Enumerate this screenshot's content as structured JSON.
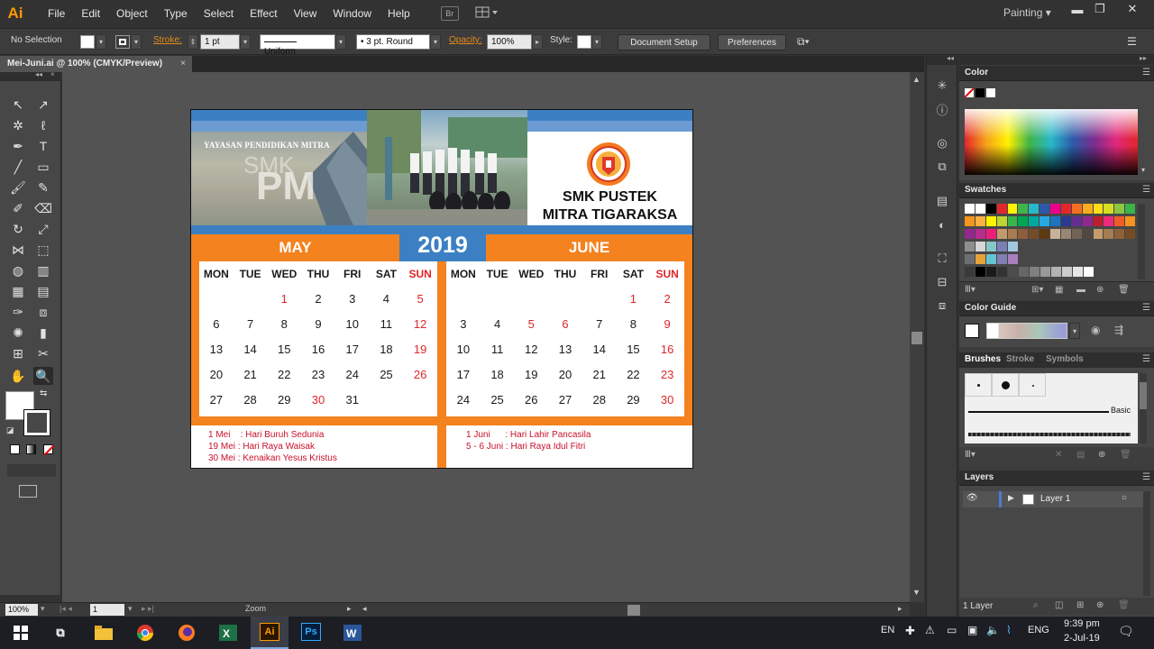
{
  "menubar": {
    "app_logo": "Ai",
    "items": [
      "File",
      "Edit",
      "Object",
      "Type",
      "Select",
      "Effect",
      "View",
      "Window",
      "Help"
    ],
    "bridge": "Br",
    "workspace": "Painting"
  },
  "controlbar": {
    "selection": "No Selection",
    "stroke_label": "Stroke:",
    "stroke_weight": "1 pt",
    "stroke_profile": "Uniform",
    "brush": "3 pt. Round",
    "opacity_label": "Opacity:",
    "opacity_value": "100%",
    "style_label": "Style:",
    "document_setup": "Document Setup",
    "preferences": "Preferences"
  },
  "document": {
    "tab_title": "Mei-Juni.ai @ 100% (CMYK/Preview)"
  },
  "statusbar": {
    "zoom": "100%",
    "artboard": "1",
    "tool": "Zoom"
  },
  "panels": {
    "color": "Color",
    "swatches": "Swatches",
    "color_guide": "Color Guide",
    "brushes_tabs": [
      "Brushes",
      "Stroke",
      "Symbols"
    ],
    "brush_basic": "Basic",
    "layers": "Layers",
    "layer_name": "Layer 1",
    "layer_count": "1 Layer"
  },
  "artwork": {
    "foundation": "YAYASAN PENDIDIKAN MITRA",
    "school_line1": "SMK PUSTEK",
    "school_line2": "MITRA TIGARAKSA",
    "year": "2019",
    "months": [
      {
        "name": "MAY",
        "days_header": [
          "MON",
          "TUE",
          "WED",
          "THU",
          "FRI",
          "SAT",
          "SUN"
        ],
        "weeks": [
          [
            "",
            "",
            "1",
            "2",
            "3",
            "4",
            "5"
          ],
          [
            "6",
            "7",
            "8",
            "9",
            "10",
            "11",
            "12"
          ],
          [
            "13",
            "14",
            "15",
            "16",
            "17",
            "18",
            "19"
          ],
          [
            "20",
            "21",
            "22",
            "23",
            "24",
            "25",
            "26"
          ],
          [
            "27",
            "28",
            "29",
            "30",
            "31",
            "",
            ""
          ]
        ],
        "holidays": [
          "1",
          "19",
          "30"
        ],
        "notes": [
          "1 Mei    : Hari Buruh Sedunia",
          "19 Mei : Hari Raya Waisak",
          "30 Mei : Kenaikan Yesus Kristus"
        ]
      },
      {
        "name": "JUNE",
        "days_header": [
          "MON",
          "TUE",
          "WED",
          "THU",
          "FRI",
          "SAT",
          "SUN"
        ],
        "weeks": [
          [
            "",
            "",
            "",
            "",
            "",
            "1",
            "2"
          ],
          [
            "3",
            "4",
            "5",
            "6",
            "7",
            "8",
            "9"
          ],
          [
            "10",
            "11",
            "12",
            "13",
            "14",
            "15",
            "16"
          ],
          [
            "17",
            "18",
            "19",
            "20",
            "21",
            "22",
            "23"
          ],
          [
            "24",
            "25",
            "26",
            "27",
            "28",
            "29",
            "30"
          ]
        ],
        "holidays": [
          "1",
          "5",
          "6"
        ],
        "notes": [
          "1 Juni      : Hari Lahir Pancasila",
          "5 - 6 Juni : Hari Raya Idul Fitri"
        ]
      }
    ]
  },
  "taskbar": {
    "apps": [
      "Task View",
      "File Explorer",
      "Chrome",
      "Firefox",
      "X",
      "Ai",
      "Ps",
      "W"
    ],
    "lang_en": "EN",
    "lang_eng": "ENG",
    "time": "9:39 pm",
    "date": "2-Jul-19"
  },
  "colors": {
    "accent_blue": "#3c80c3",
    "accent_orange": "#f4821f",
    "holiday_red": "#e02529"
  }
}
